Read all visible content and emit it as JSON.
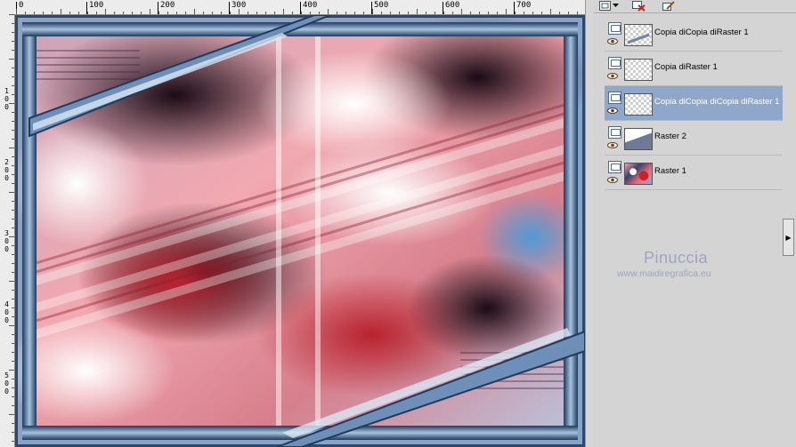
{
  "ruler": {
    "top_labels": [
      "0",
      "100",
      "200",
      "300",
      "400",
      "500",
      "600",
      "700"
    ],
    "left_labels": [
      [
        "1",
        "0",
        "0"
      ],
      [
        "2",
        "0",
        "0"
      ],
      [
        "3",
        "0",
        "0"
      ],
      [
        "4",
        "0",
        "0"
      ],
      [
        "5",
        "0",
        "0"
      ]
    ]
  },
  "layers": [
    {
      "name": "Copia diCopia diRaster 1",
      "selected": false,
      "thumb": "diag"
    },
    {
      "name": "Copia diRaster 1",
      "selected": false,
      "thumb": "checker"
    },
    {
      "name": "Copia diCopia diCopia diRaster 1",
      "selected": true,
      "thumb": "checker"
    },
    {
      "name": "Raster 2",
      "selected": false,
      "thumb": "raster2"
    },
    {
      "name": "Raster 1",
      "selected": false,
      "thumb": "raster1"
    }
  ],
  "watermark": {
    "title": "Pinuccia",
    "url": "www.maidiregrafica.eu"
  },
  "colors": {
    "frame_blue": "#3d5f8a",
    "selection": "#8fa7c9"
  },
  "icons": {
    "tb_new": "new-layer-icon",
    "tb_dropdown": "chevron-down-icon",
    "tb_delete": "delete-layer-icon",
    "tb_edit": "edit-icon",
    "scroll": "chevron-right-icon"
  }
}
